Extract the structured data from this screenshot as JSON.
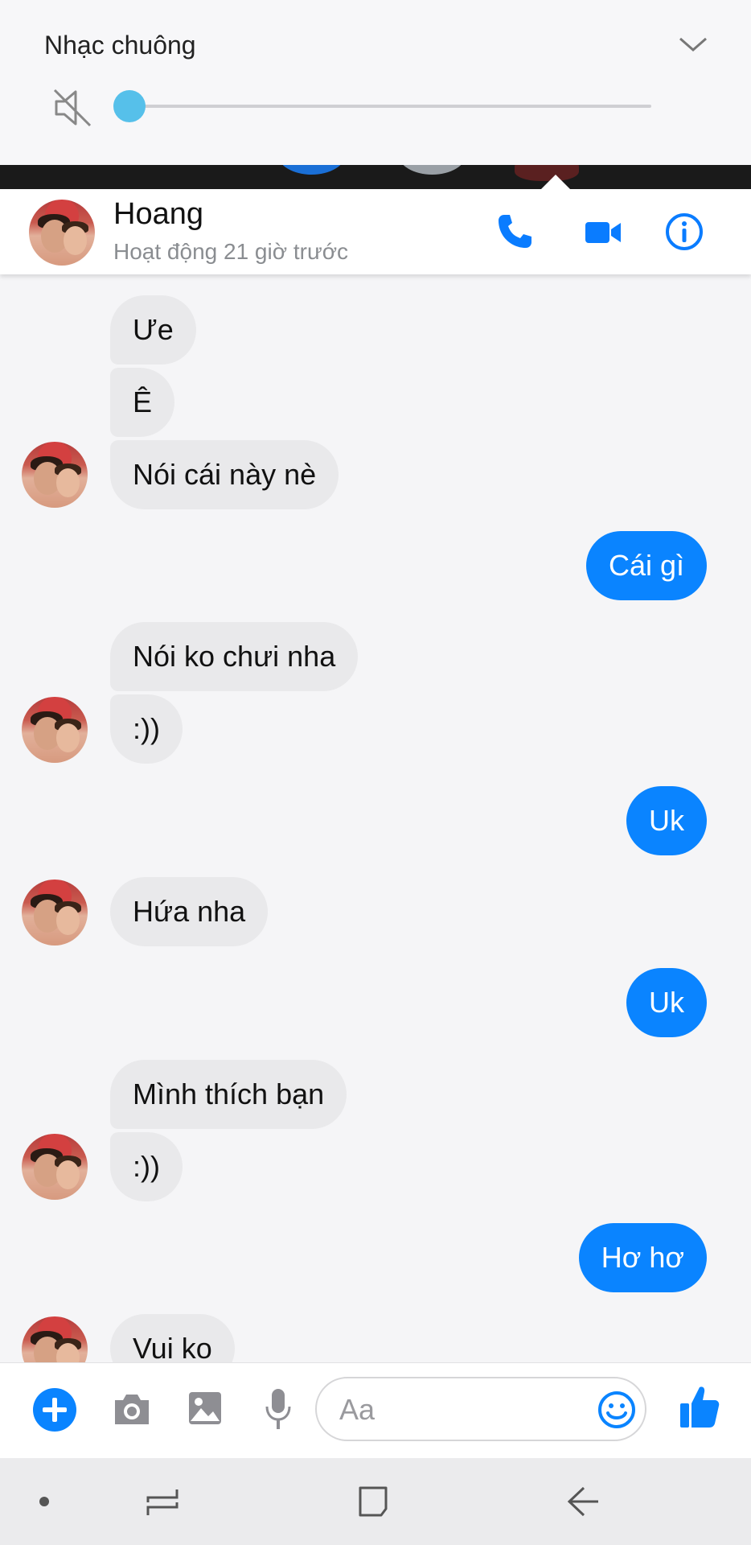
{
  "volume_panel": {
    "title": "Nhạc chuông",
    "level": 0,
    "icons": {
      "mute": "speaker-muted-icon",
      "collapse": "chevron-down-icon"
    }
  },
  "header": {
    "name": "Hoang",
    "status": "Hoạt động 21 giờ trước",
    "icons": [
      "phone-icon",
      "video-camera-icon",
      "info-icon"
    ]
  },
  "messages": [
    {
      "from": "them",
      "text": "Ưe"
    },
    {
      "from": "them",
      "text": "Ê"
    },
    {
      "from": "them",
      "text": "Nói cái này nè"
    },
    {
      "from": "me",
      "text": "Cái gì"
    },
    {
      "from": "them",
      "text": "Nói ko chưi nha"
    },
    {
      "from": "them",
      "text": ":))"
    },
    {
      "from": "me",
      "text": "Uk"
    },
    {
      "from": "them",
      "text": "Hứa nha"
    },
    {
      "from": "me",
      "text": "Uk"
    },
    {
      "from": "them",
      "text": "Mình thích bạn"
    },
    {
      "from": "them",
      "text": ":))"
    },
    {
      "from": "me",
      "text": "Hơ hơ"
    },
    {
      "from": "them",
      "text": "Vui ko"
    }
  ],
  "composer": {
    "placeholder": "Aa",
    "icons": [
      "plus-icon",
      "camera-icon",
      "image-icon",
      "microphone-icon",
      "emoji-icon",
      "thumbs-up-icon"
    ],
    "accent": "#0a84ff"
  },
  "navbar": {
    "buttons": [
      "nav-dot",
      "recent-apps",
      "home",
      "back"
    ]
  },
  "colors": {
    "accent": "#0a84ff",
    "incoming_bubble": "#e9e9eb",
    "slider_thumb": "#56c0ea"
  }
}
